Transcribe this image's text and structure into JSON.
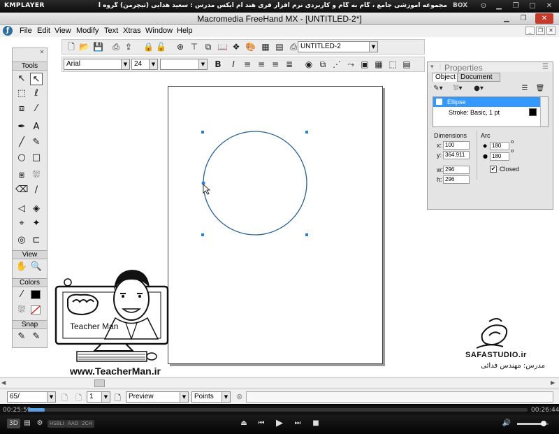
{
  "player": {
    "logo": "KMPLAYER",
    "title": "مجموعه آموزشی جامع ، گام به گام و کاربردی نرم افزار فری هند ام ایکس  مدرس : سعید هدایی (تیچرمن) گروه آموزشی پادشاه گرافیست ها",
    "box_label": "BOX",
    "time_elapsed": "00:25:59",
    "time_total": "00:26:44",
    "seek_progress": 0.034,
    "volume": 0.8,
    "badges": [
      "3D",
      "HSBLI",
      "AAO",
      "2CH"
    ]
  },
  "app": {
    "title": "Macromedia FreeHand MX - [UNTITLED-2*]",
    "menu": [
      "File",
      "Edit",
      "View",
      "Modify",
      "Text",
      "Xtras",
      "Window",
      "Help"
    ],
    "document_combo": "UNTITLED-2",
    "font_combo": "Arial",
    "size_combo": "24"
  },
  "tools": {
    "title": "Tools",
    "view_header": "View",
    "colors_header": "Colors",
    "snap_header": "Snap"
  },
  "properties": {
    "title": "Properties",
    "tab_object": "Object",
    "tab_document": "Document",
    "rows": [
      "Ellipse",
      "Stroke: Basic, 1 pt"
    ],
    "dimensions_label": "Dimensions",
    "arc_label": "Arc",
    "x_label": "x:",
    "y_label": "y:",
    "w_label": "w:",
    "h_label": "h:",
    "x": "100",
    "y": "364.911",
    "w": "296",
    "h": "296",
    "arc_start": "180",
    "arc_end": "180",
    "closed_label": "Closed"
  },
  "status": {
    "zoom": "65/",
    "page": "1",
    "view_mode": "Preview",
    "units": "Points"
  },
  "watermarks": {
    "teacher_url": "www.TeacherMan.ir",
    "teacher_name": "Teacher Man",
    "studio_name": "SAFASTUDIO.ir",
    "studio_teacher": "مدرس: مهندس فدائی"
  }
}
